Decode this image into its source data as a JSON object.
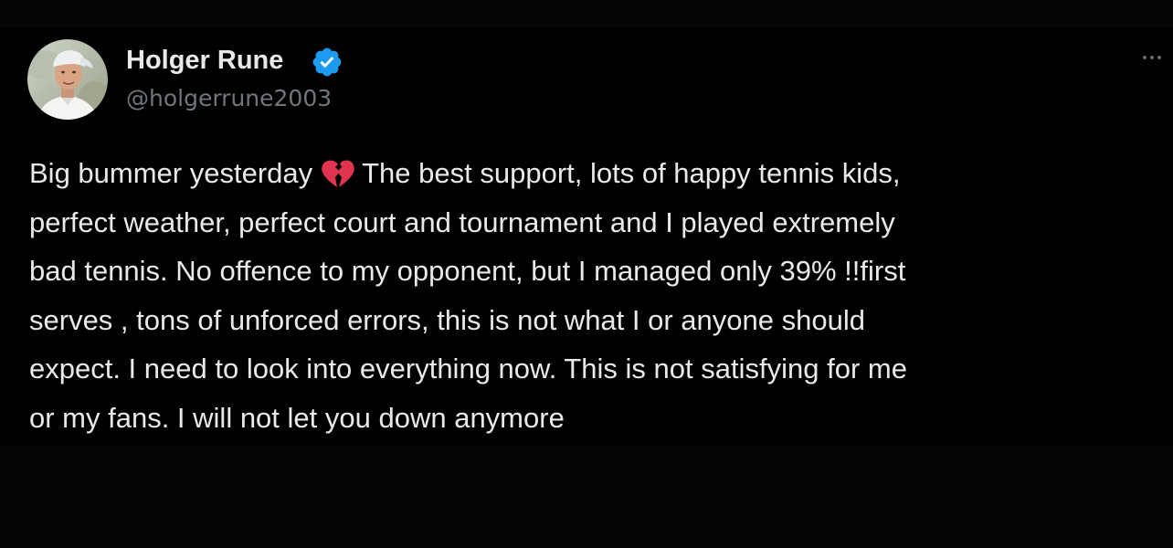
{
  "tweet": {
    "author": {
      "display_name": "Holger Rune",
      "handle": "@holgerrune2003",
      "verified": true,
      "verified_color": "#1d9bf0",
      "avatar": "profile-photo"
    },
    "more_icon": "ellipsis-icon",
    "text_lines": [
      {
        "before": "Big bummer yesterday",
        "emoji": "broken-heart-icon",
        "after": "The best support, lots of happy tennis kids,"
      },
      {
        "text": "perfect weather, perfect court and tournament and I played extremely"
      },
      {
        "text": "bad tennis. No offence to my opponent, but I managed only 39% !!first"
      },
      {
        "text": "serves , tons of unforced errors, this is not what I or anyone should"
      },
      {
        "text": "expect.  I need to look into everything now. This is not satisfying for me"
      },
      {
        "text": "or my fans. I will not let you down anymore"
      }
    ],
    "colors": {
      "background": "#000000",
      "text": "#e7e9ea",
      "secondary_text": "#71767b",
      "emoji": "#e0334f"
    }
  }
}
